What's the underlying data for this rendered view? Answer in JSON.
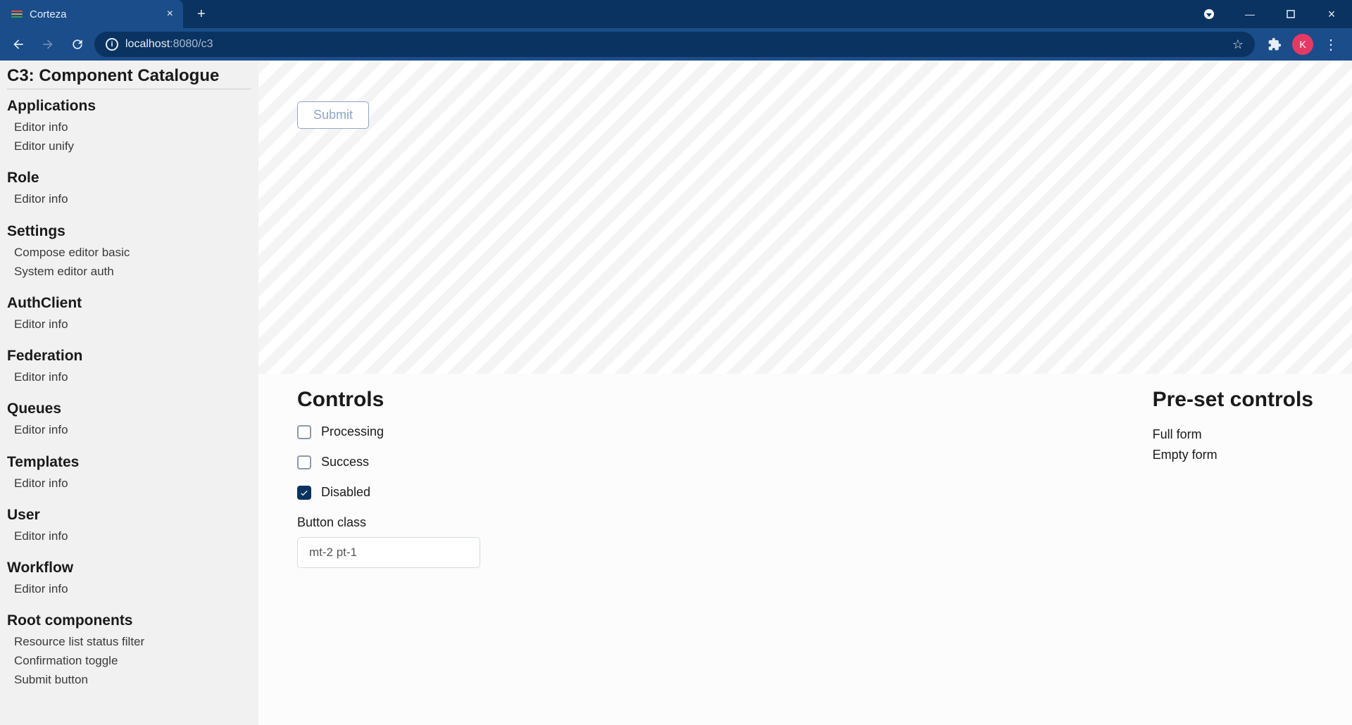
{
  "window": {
    "tab_title": "Corteza",
    "url_host": "localhost",
    "url_port_path": ":8080/c3",
    "avatar_letter": "K"
  },
  "page_title": "C3: Component Catalogue",
  "sidebar": [
    {
      "heading": "Applications",
      "items": [
        "Editor info",
        "Editor unify"
      ]
    },
    {
      "heading": "Role",
      "items": [
        "Editor info"
      ]
    },
    {
      "heading": "Settings",
      "items": [
        "Compose editor basic",
        "System editor auth"
      ]
    },
    {
      "heading": "AuthClient",
      "items": [
        "Editor info"
      ]
    },
    {
      "heading": "Federation",
      "items": [
        "Editor info"
      ]
    },
    {
      "heading": "Queues",
      "items": [
        "Editor info"
      ]
    },
    {
      "heading": "Templates",
      "items": [
        "Editor info"
      ]
    },
    {
      "heading": "User",
      "items": [
        "Editor info"
      ]
    },
    {
      "heading": "Workflow",
      "items": [
        "Editor info"
      ]
    },
    {
      "heading": "Root components",
      "items": [
        "Resource list status filter",
        "Confirmation toggle",
        "Submit button"
      ]
    }
  ],
  "preview": {
    "submit_label": "Submit"
  },
  "controls": {
    "heading": "Controls",
    "processing_label": "Processing",
    "processing_checked": false,
    "success_label": "Success",
    "success_checked": false,
    "disabled_label": "Disabled",
    "disabled_checked": true,
    "button_class_label": "Button class",
    "button_class_value": "mt-2 pt-1"
  },
  "presets": {
    "heading": "Pre-set controls",
    "full_form": "Full form",
    "empty_form": "Empty form"
  }
}
